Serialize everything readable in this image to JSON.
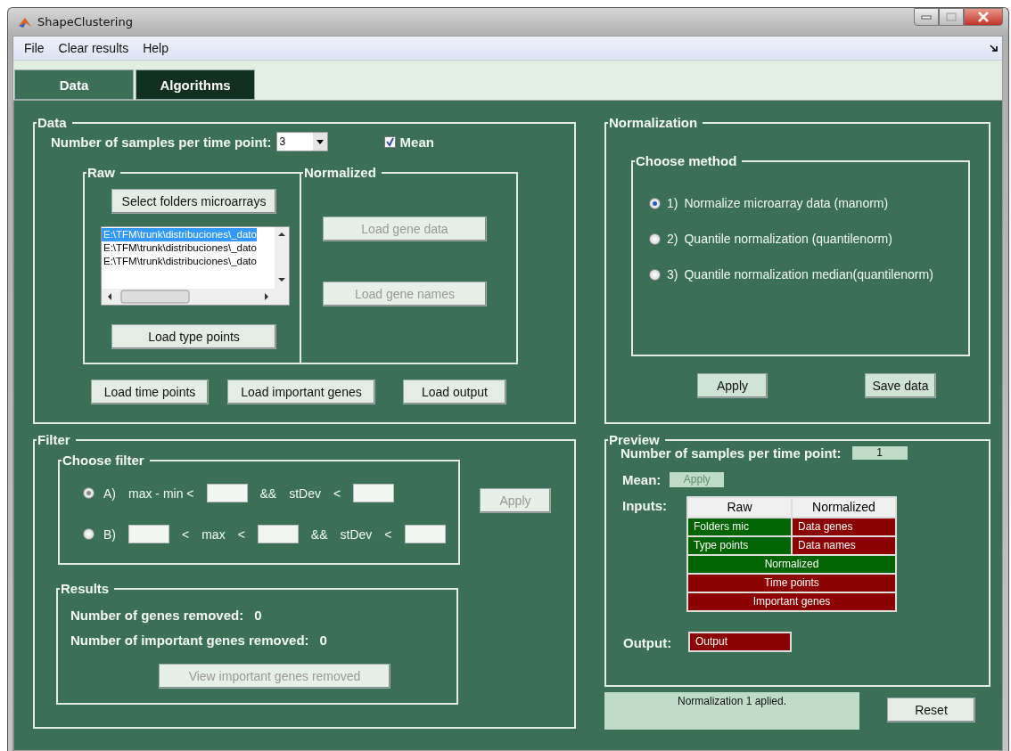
{
  "window": {
    "title": "ShapeClustering"
  },
  "menu": [
    "File",
    "Clear results",
    "Help"
  ],
  "tabs": [
    {
      "label": "Data",
      "selected": false
    },
    {
      "label": "Algorithms",
      "selected": true
    }
  ],
  "data_panel": {
    "title": "Data",
    "samples_label": "Number of samples per time point:",
    "samples_value": "3",
    "mean": {
      "label": "Mean",
      "checked": true
    },
    "raw": {
      "title": "Raw",
      "select_button": {
        "label": "Select folders microarrays",
        "disabled": false
      },
      "folders": [
        {
          "text": "E:\\TFM\\trunk\\distribuciones\\_dato",
          "selected": true
        },
        {
          "text": "E:\\TFM\\trunk\\distribuciones\\_dato",
          "selected": false
        },
        {
          "text": "E:\\TFM\\trunk\\distribuciones\\_dato",
          "selected": false
        }
      ],
      "type_button": {
        "label": "Load type points",
        "disabled": false
      }
    },
    "normalized": {
      "title": "Normalized",
      "buttons": [
        {
          "label": "Load gene data",
          "disabled": true
        },
        {
          "label": "Load gene names",
          "disabled": true
        }
      ]
    },
    "buttons": [
      {
        "label": "Load time points",
        "disabled": false
      },
      {
        "label": "Load important genes",
        "disabled": false
      },
      {
        "label": "Load output",
        "disabled": false
      }
    ]
  },
  "normalization": {
    "title": "Normalization",
    "group_title": "Choose method",
    "methods": [
      {
        "number": "1)",
        "label": "Normalize microarray data (manorm)",
        "selected": true
      },
      {
        "number": "2)",
        "label": "Quantile normalization (quantilenorm)",
        "selected": false
      },
      {
        "number": "3)",
        "label": "Quantile normalization median(quantilenorm)",
        "selected": false
      }
    ],
    "buttons": [
      {
        "label": "Apply",
        "disabled": false
      },
      {
        "label": "Save data",
        "disabled": false
      }
    ]
  },
  "filter": {
    "title": "Filter",
    "group_title": "Choose filter",
    "options": [
      {
        "letter": "A)",
        "selected": true,
        "tokens": [
          {
            "kind": "text",
            "text": "max - min <"
          },
          {
            "kind": "input"
          },
          {
            "kind": "text",
            "text": "&&"
          },
          {
            "kind": "text",
            "text": "stDev"
          },
          {
            "kind": "text",
            "text": "<"
          },
          {
            "kind": "input"
          }
        ]
      },
      {
        "letter": "B)",
        "selected": false,
        "tokens": [
          {
            "kind": "input"
          },
          {
            "kind": "text",
            "text": "<"
          },
          {
            "kind": "text",
            "text": "max"
          },
          {
            "kind": "text",
            "text": "<"
          },
          {
            "kind": "input"
          },
          {
            "kind": "text",
            "text": "&&"
          },
          {
            "kind": "text",
            "text": "stDev"
          },
          {
            "kind": "text",
            "text": "<"
          },
          {
            "kind": "input"
          }
        ]
      }
    ],
    "apply": {
      "label": "Apply",
      "disabled": true
    },
    "results": {
      "title": "Results",
      "lines": [
        {
          "label": "Number of genes removed:",
          "value": "0"
        },
        {
          "label": "Number of important genes removed:",
          "value": "0"
        }
      ],
      "button": {
        "label": "View important genes removed",
        "disabled": true
      }
    }
  },
  "preview": {
    "title": "Preview",
    "samples_label": "Number of samples per time point:",
    "samples_value": "1",
    "mean_label": "Mean:",
    "mean_value": "Apply",
    "inputs_label": "Inputs:",
    "columns": [
      "Raw",
      "Normalized"
    ],
    "pair_rows": [
      [
        {
          "text": "Folders mic",
          "color": "#006400"
        },
        {
          "text": "Data genes",
          "color": "#8b0000"
        }
      ],
      [
        {
          "text": "Type points",
          "color": "#006400"
        },
        {
          "text": "Data names",
          "color": "#8b0000"
        }
      ]
    ],
    "wide_rows": [
      {
        "text": "Normalized",
        "color": "#006400"
      },
      {
        "text": "Time points",
        "color": "#8b0000"
      },
      {
        "text": "Important genes",
        "color": "#8b0000"
      }
    ],
    "output_label": "Output:",
    "output": {
      "text": "Output",
      "color": "#8b0000"
    }
  },
  "status": "Normalization 1 aplied.",
  "reset": {
    "label": "Reset",
    "disabled": false
  }
}
